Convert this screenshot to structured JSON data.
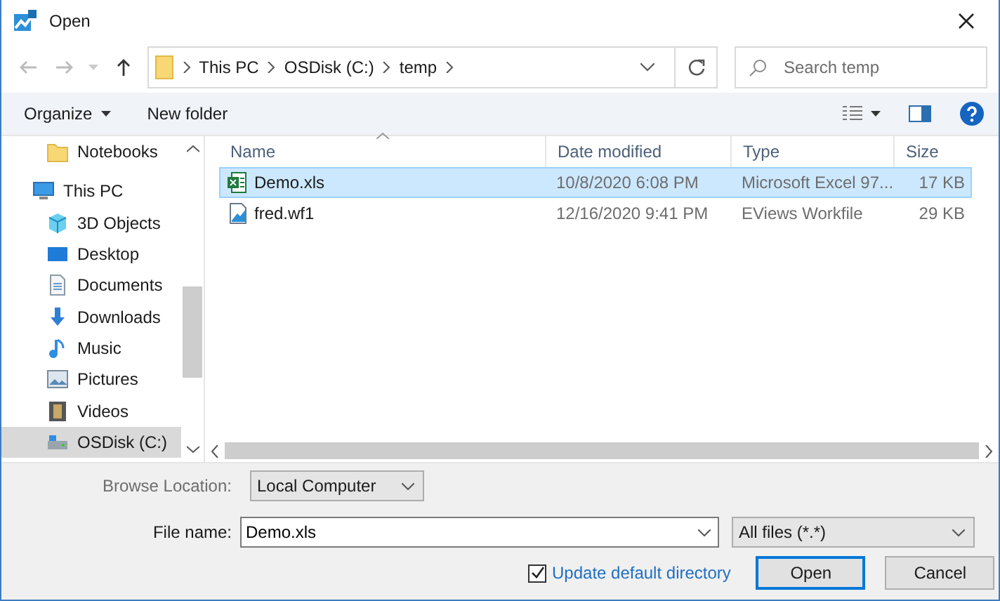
{
  "window": {
    "title": "Open"
  },
  "address_bar": {
    "segments": [
      "This PC",
      "OSDisk (C:)",
      "temp"
    ]
  },
  "search": {
    "placeholder": "Search temp"
  },
  "toolbar": {
    "buttons": [
      {
        "label": "Organize",
        "kind": "menu"
      },
      {
        "label": "New folder",
        "kind": "plain"
      }
    ]
  },
  "sidebar": {
    "items": [
      {
        "label": "Notebooks",
        "kind": "folder",
        "selected": false
      },
      {
        "label": "This PC",
        "kind": "pc",
        "selected": false,
        "children": [
          {
            "label": "3D Objects",
            "kind": "cube",
            "selected": false
          },
          {
            "label": "Desktop",
            "kind": "desktop",
            "selected": false
          },
          {
            "label": "Documents",
            "kind": "document",
            "selected": false
          },
          {
            "label": "Downloads",
            "kind": "download",
            "selected": false
          },
          {
            "label": "Music",
            "kind": "music",
            "selected": false
          },
          {
            "label": "Pictures",
            "kind": "picture",
            "selected": false
          },
          {
            "label": "Videos",
            "kind": "video",
            "selected": false
          },
          {
            "label": "OSDisk (C:)",
            "kind": "drive",
            "selected": true
          }
        ]
      }
    ]
  },
  "table": {
    "columns": [
      "Name",
      "Date modified",
      "Type",
      "Size"
    ],
    "rows": [
      {
        "name": "Demo.xls",
        "kind": "excel",
        "date": "10/8/2020 6:08 PM",
        "type": "Microsoft Excel 97...",
        "size": "17 KB",
        "selected": true
      },
      {
        "name": "fred.wf1",
        "kind": "workfile",
        "date": "12/16/2020 9:41 PM",
        "type": "EViews Workfile",
        "size": "29 KB",
        "selected": false
      }
    ]
  },
  "browse_location": {
    "label": "Browse Location:",
    "value": "Local Computer"
  },
  "file_name": {
    "label": "File name:",
    "value": "Demo.xls"
  },
  "file_type": {
    "value": "All files (*.*)"
  },
  "update_default": {
    "label": "Update default directory",
    "checked": true
  },
  "buttons": [
    {
      "label": "Open",
      "default": true
    },
    {
      "label": "Cancel",
      "default": false
    }
  ]
}
